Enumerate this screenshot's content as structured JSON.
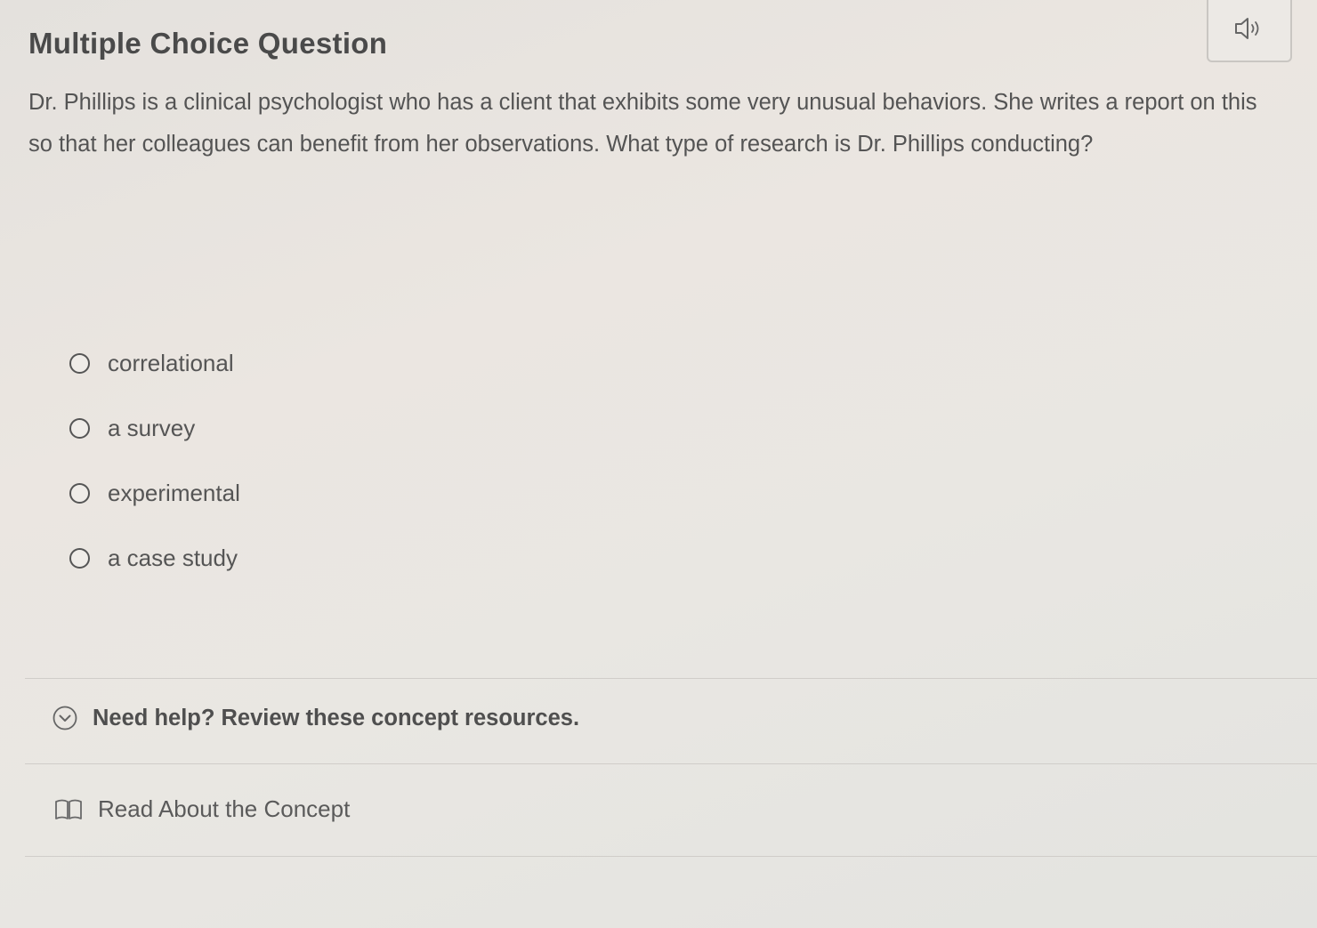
{
  "question": {
    "heading": "Multiple Choice Question",
    "text": "Dr. Phillips is a clinical psychologist who has a client that exhibits some very unusual behaviors. She writes a report on this so that her colleagues can benefit from her observations. What type of research is Dr. Phillips conducting?",
    "audio_icon": "speaker-icon"
  },
  "options": [
    {
      "label": "correlational"
    },
    {
      "label": "a survey"
    },
    {
      "label": "experimental"
    },
    {
      "label": "a case study"
    }
  ],
  "help": {
    "label": "Need help? Review these concept resources.",
    "icon": "chevron-down-circle-icon"
  },
  "concept": {
    "label": "Read About the Concept",
    "icon": "book-icon"
  },
  "colors": {
    "text": "#4a4a4a",
    "divider": "#d0cdc9"
  }
}
